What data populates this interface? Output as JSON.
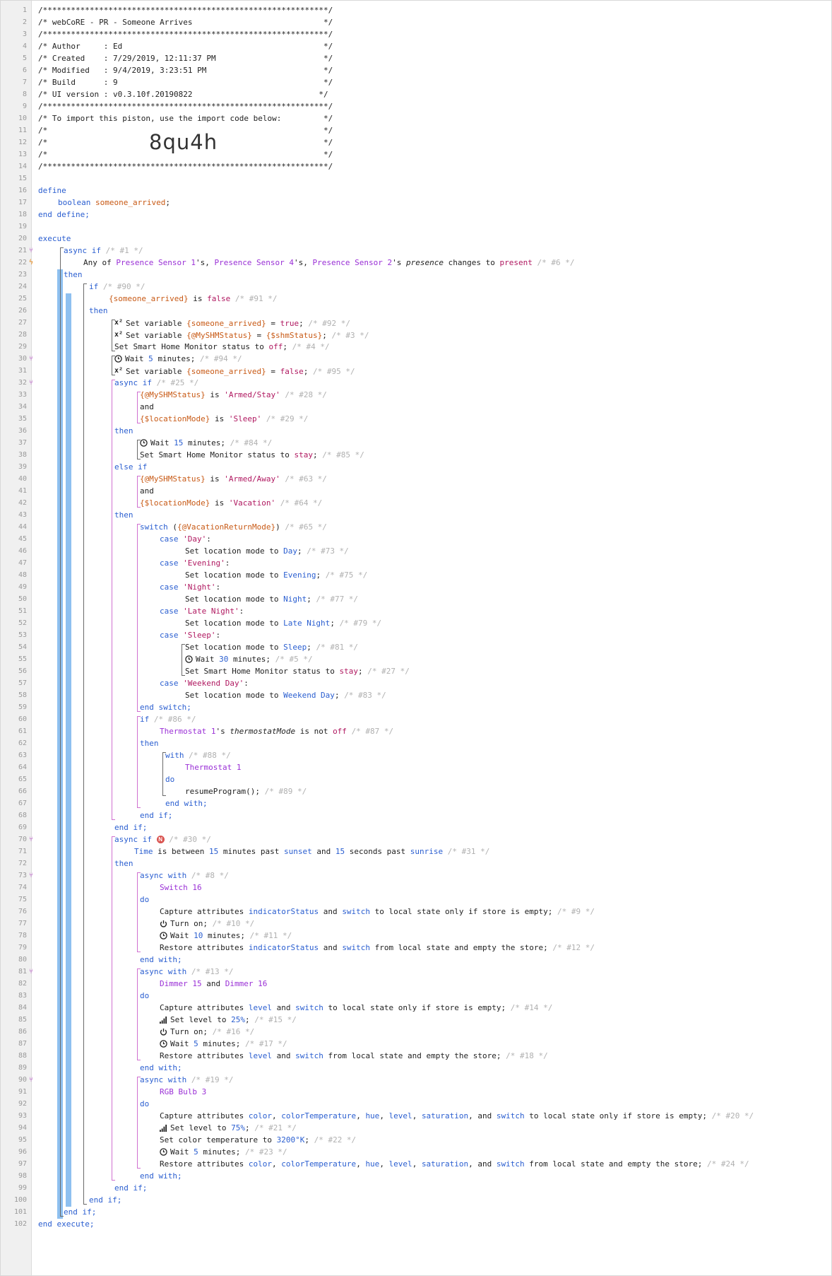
{
  "line_numbers": [
    "1",
    "2",
    "3",
    "4",
    "5",
    "6",
    "7",
    "8",
    "9",
    "10",
    "11",
    "12",
    "13",
    "14",
    "15",
    "16",
    "17",
    "18",
    "19",
    "20",
    "21",
    "22",
    "23",
    "24",
    "25",
    "26",
    "27",
    "28",
    "29",
    "30",
    "31",
    "32",
    "33",
    "34",
    "35",
    "36",
    "37",
    "38",
    "39",
    "40",
    "41",
    "42",
    "43",
    "44",
    "45",
    "46",
    "47",
    "48",
    "49",
    "50",
    "51",
    "52",
    "53",
    "54",
    "55",
    "56",
    "57",
    "58",
    "59",
    "60",
    "61",
    "62",
    "63",
    "64",
    "65",
    "66",
    "67",
    "68",
    "69",
    "70",
    "71",
    "72",
    "73",
    "74",
    "75",
    "76",
    "77",
    "78",
    "79",
    "80",
    "81",
    "82",
    "83",
    "84",
    "85",
    "86",
    "87",
    "88",
    "89",
    "90",
    "91",
    "92",
    "93",
    "94",
    "95",
    "96",
    "97",
    "98",
    "99",
    "100",
    "101",
    "102"
  ],
  "header": {
    "border": "/*************************************************************/",
    "title": "/* webCoRE - PR - Someone Arrives                            */",
    "author": "/* Author     : Ed                                           */",
    "created": "/* Created    : 7/29/2019, 12:11:37 PM                       */",
    "modified": "/* Modified   : 9/4/2019, 3:23:51 PM                         */",
    "build": "/* Build      : 9                                            */",
    "ui_version": "/* UI version : v0.3.10f.20190822                           */",
    "import_note": "/* To import this piston, use the import code below:         */",
    "blank": "/*                                                           */",
    "import_code": "8qu4h"
  },
  "icons": {
    "gutter_async": "async-branch-icon",
    "gutter_trigger": "lightning-trigger-icon",
    "variable": "superscript-x2-icon",
    "wait": "clock-icon",
    "power": "power-icon",
    "level": "signal-bars-icon",
    "condition_badge": "n-badge-icon"
  },
  "colors": {
    "keyword": "#2a5ed0",
    "device": "#9a30d6",
    "variable": "#c85a16",
    "comment": "#b0b0b0",
    "string": "#b01860",
    "block_bar": "#8ec0f0"
  },
  "t": {
    "define": "define",
    "boolean": "boolean",
    "someone_arrived": "someone_arrived",
    "semi": ";",
    "end_define": "end define;",
    "execute": "execute",
    "end_execute": "end execute;",
    "async": "async",
    "if": "if",
    "then": "then",
    "else_if": "else if",
    "end_if": "end if;",
    "and": "and",
    "is": "is",
    "with": "with",
    "do": "do",
    "end_with": "end with;",
    "switch_kw": "switch",
    "end_switch": "end switch;",
    "case": "case",
    "c1": "/* #1 */",
    "any_of": "Any of ",
    "ps1": "Presence Sensor 1",
    "s_comma": "'s, ",
    "ps4": "Presence Sensor 4",
    "s_or": "'s, or ",
    "ps2": "Presence Sensor 2",
    "s_": "'s ",
    "presence": "presence",
    "changes_to": " changes to ",
    "present": "present",
    "c6": "/* #6 */",
    "c90": "/* #90 */",
    "v_someone_arrived": "{someone_arrived}",
    "false": "false",
    "true": "true",
    "c91": "/* #91 */",
    "set_variable": "Set variable ",
    "eq": " = ",
    "c92": "/* #92 */",
    "v_myshm": "{@MySHMStatus}",
    "v_shm": "{$shmStatus}",
    "c3": "/* #3 */",
    "set_shm": "Set Smart Home Monitor status to ",
    "off": "off",
    "c4": "/* #4 */",
    "wait": "Wait ",
    "n5": "5",
    "minutes": " minutes;",
    "c94": "/* #94 */",
    "c95": "/* #95 */",
    "c25": "/* #25 */",
    "armed_stay": "'Armed/Stay'",
    "c28": "/* #28 */",
    "v_locmode": "{$locationMode}",
    "sleep_str": "'Sleep'",
    "c29": "/* #29 */",
    "n15": "15",
    "c84": "/* #84 */",
    "stay": "stay",
    "c85": "/* #85 */",
    "armed_away": "'Armed/Away'",
    "c63": "/* #63 */",
    "vacation": "'Vacation'",
    "c64": "/* #64 */",
    "v_vacreturn": "{@VacationReturnMode}",
    "c65": "/* #65 */",
    "case_day": "'Day'",
    "colon": ":",
    "set_loc": "Set location mode to ",
    "day": "Day",
    "c73": "/* #73 */",
    "case_evening": "'Evening'",
    "evening": "Evening",
    "c75": "/* #75 */",
    "case_night": "'Night'",
    "night": "Night",
    "c77": "/* #77 */",
    "case_latenight": "'Late Night'",
    "latenight": "Late Night",
    "c79": "/* #79 */",
    "case_sleep": "'Sleep'",
    "sleep": "Sleep",
    "c81": "/* #81 */",
    "n30": "30",
    "c5": "/* #5 */",
    "c27": "/* #27 */",
    "case_weekend": "'Weekend Day'",
    "weekend": "Weekend Day",
    "c83": "/* #83 */",
    "c86": "/* #86 */",
    "thermostat1": "Thermostat 1",
    "thermostat_mode": "thermostatMode",
    "is_not": " is not ",
    "c87": "/* #87 */",
    "c88": "/* #88 */",
    "resume": "resumeProgram();",
    "c89": "/* #89 */",
    "c30": "/* #30 */",
    "n_badge": "N",
    "time": "Time",
    "is_between": " is between ",
    "minutes_past": " minutes past ",
    "sunset": "sunset",
    "and_sp": " and ",
    "seconds_past": " seconds past ",
    "sunrise": "sunrise",
    "c31": "/* #31 */",
    "c8": "/* #8 */",
    "switch16": "Switch 16",
    "capture": "Capture attributes ",
    "indicator": "indicatorStatus",
    "switch_attr": "switch",
    "to_local": " to local state only if store is empty;",
    "c9": "/* #9 */",
    "turn_on": "Turn on;",
    "c10": "/* #10 */",
    "n10": "10",
    "c11": "/* #11 */",
    "restore": "Restore attributes ",
    "from_local": " from local state and empty the store;",
    "c12": "/* #12 */",
    "c13": "/* #13 */",
    "dimmer15": "Dimmer 15",
    "dimmer16": "Dimmer 16",
    "level": "level",
    "c14": "/* #14 */",
    "set_level": "Set level to ",
    "l25": "25%",
    "c15": "/* #15 */",
    "c16": "/* #16 */",
    "c17": "/* #17 */",
    "c18": "/* #18 */",
    "c19": "/* #19 */",
    "rgbbulb3": "RGB Bulb 3",
    "color": "color",
    "colortemp": "colorTemperature",
    "hue": "hue",
    "saturation": "saturation",
    "comma": ", ",
    "comma_and": ", and ",
    "c20": "/* #20 */",
    "l75": "75%",
    "c21": "/* #21 */",
    "set_ct": "Set color temperature to ",
    "ct3200": "3200°K",
    "c22": "/* #22 */",
    "c23": "/* #23 */",
    "c24": "/* #24 */",
    "lparen": " (",
    "rparen": ")",
    "semicolon": ";"
  }
}
